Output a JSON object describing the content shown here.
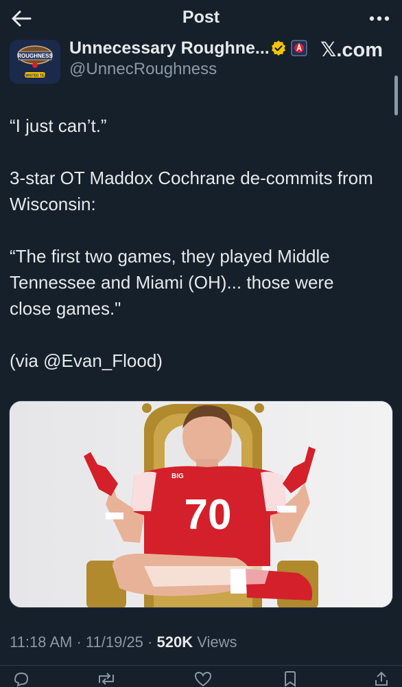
{
  "header": {
    "title": "Post",
    "back_icon": "arrow-left-icon",
    "more_icon": "more-horizontal-icon"
  },
  "author": {
    "name": "Unnecessary Roughne...",
    "handle": "@UnnecRoughness",
    "verified_color": "#f5c400",
    "source": ".com",
    "avatar_text": "ROUGHNESS",
    "avatar_subtext": "TWISTED TEA"
  },
  "tweet": {
    "paragraphs": [
      "“I just can’t.”",
      "3-star OT Maddox Cochrane de-commits from Wisconsin:",
      "“The first two games, they played Middle Tennessee and Miami (OH)... those were close games.\"",
      "(via @Evan_Flood)"
    ]
  },
  "media": {
    "jersey_number": "70",
    "jersey_brand": "BIG",
    "jersey_color": "#d4202a"
  },
  "meta": {
    "time": "11:18 AM",
    "date": "11/19/25",
    "views_count": "520K",
    "views_label": "Views",
    "separator": "·"
  },
  "colors": {
    "background": "#15202b",
    "text": "#e7e9ea",
    "secondary": "#8b98a5"
  }
}
